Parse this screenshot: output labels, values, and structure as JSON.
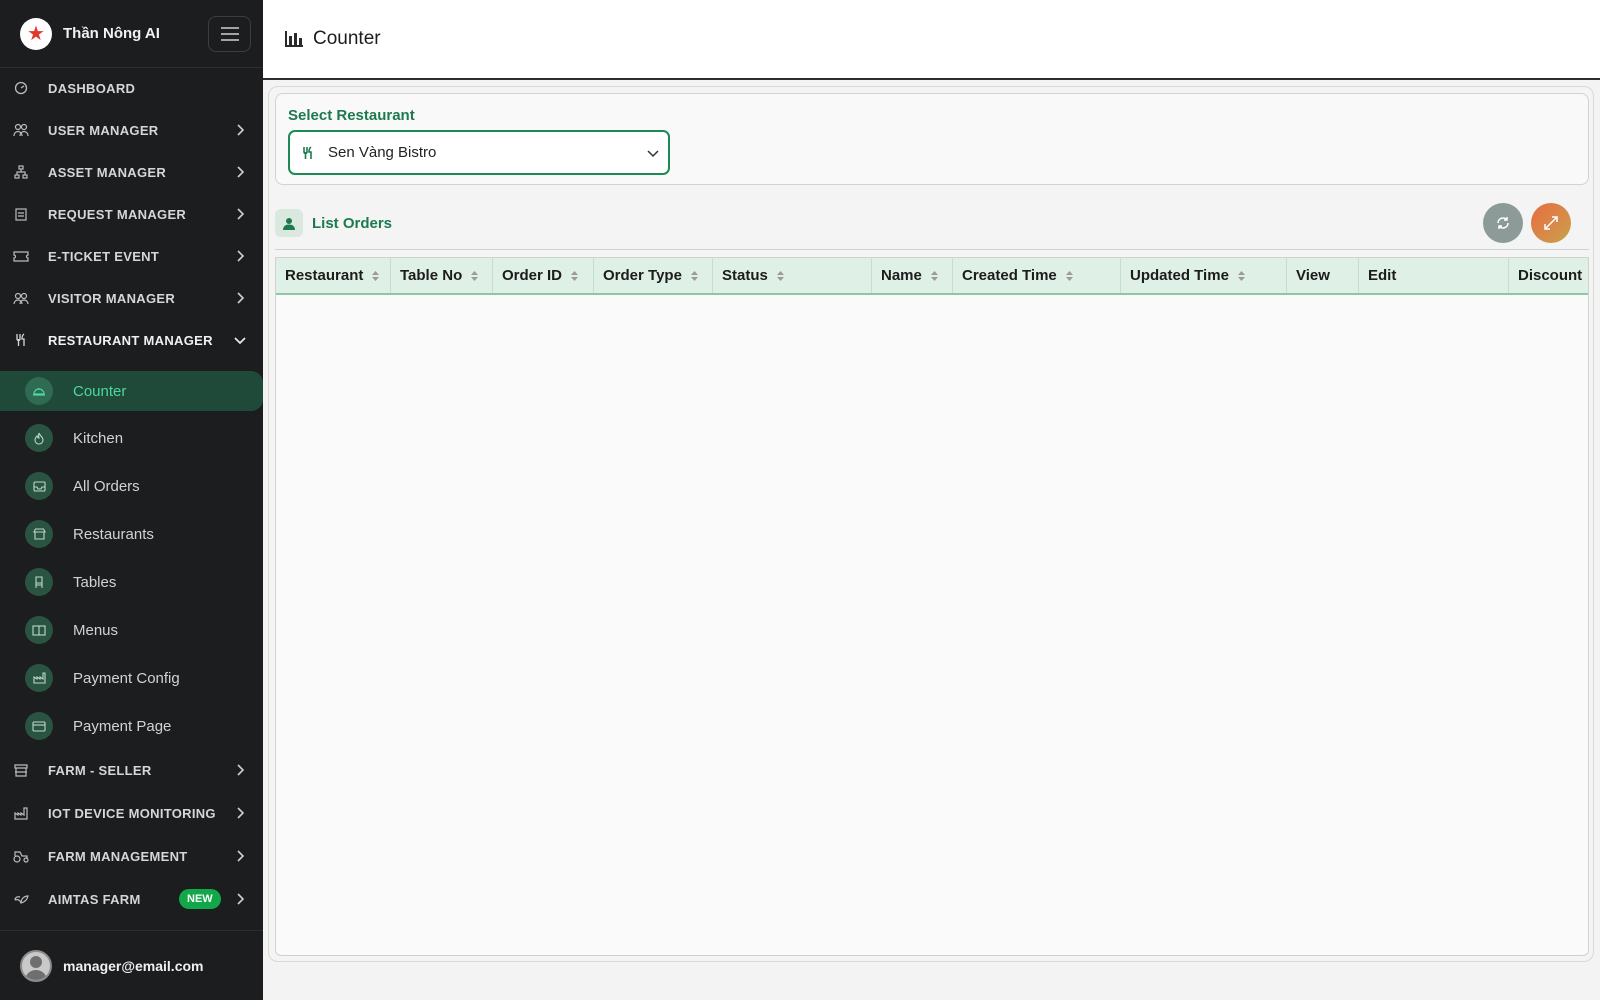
{
  "brand": {
    "name": "Thần Nông AI"
  },
  "nav": {
    "dashboard": "DASHBOARD",
    "user_manager": "USER MANAGER",
    "asset_manager": "ASSET MANAGER",
    "request_manager": "REQUEST MANAGER",
    "eticket_event": "E-TICKET EVENT",
    "visitor_manager": "VISITOR MANAGER",
    "restaurant_manager": "RESTAURANT MANAGER",
    "farm_seller": "FARM - SELLER",
    "iot_monitoring": "IOT DEVICE MONITORING",
    "farm_management": "FARM MANAGEMENT",
    "aimtas_farm": "AIMTAS FARM",
    "aimtas_badge": "NEW"
  },
  "restaurant_submenu": {
    "counter": "Counter",
    "kitchen": "Kitchen",
    "all_orders": "All Orders",
    "restaurants": "Restaurants",
    "tables": "Tables",
    "menus": "Menus",
    "payment_config": "Payment Config",
    "payment_page": "Payment Page"
  },
  "user": {
    "email": "manager@email.com"
  },
  "page": {
    "title": "Counter"
  },
  "restaurant_select": {
    "label": "Select Restaurant",
    "value": "Sen Vàng Bistro"
  },
  "orders": {
    "title": "List Orders",
    "columns": [
      "Restaurant",
      "Table No",
      "Order ID",
      "Order Type",
      "Status",
      "Name",
      "Created Time",
      "Updated Time",
      "View",
      "Edit",
      "Discount"
    ],
    "rows": []
  },
  "colors": {
    "accent": "#1d7a4f",
    "sidebar_bg": "#1c1d1f",
    "active_bg": "#1f4a39",
    "badge_green": "#12a84a"
  }
}
